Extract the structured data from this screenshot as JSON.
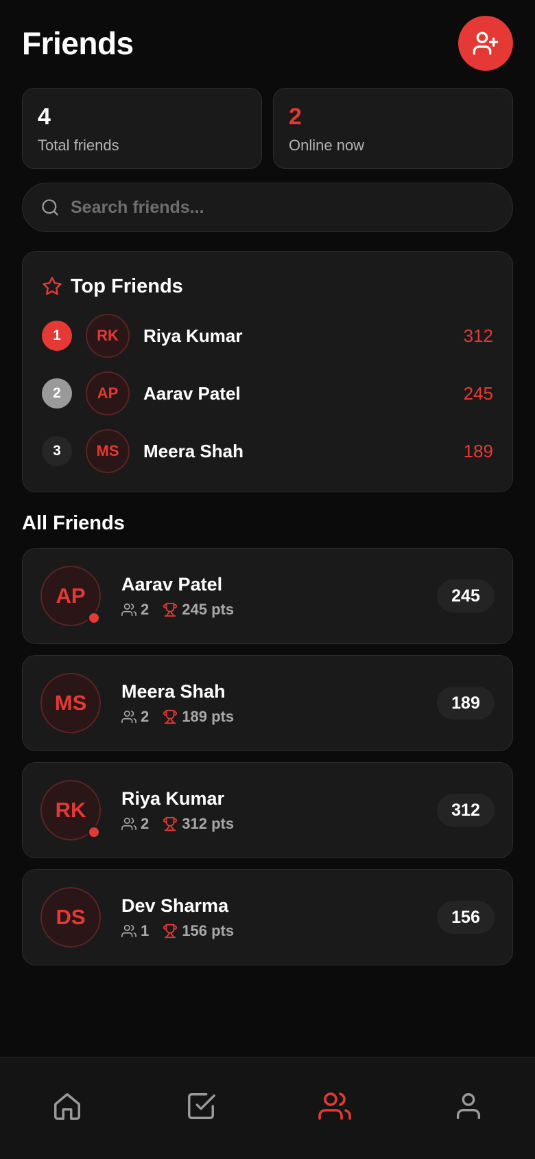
{
  "header": {
    "title": "Friends",
    "add_button_icon": "user-plus-icon"
  },
  "stats": [
    {
      "value": "4",
      "label": "Total friends"
    },
    {
      "value": "2",
      "label": "Online now"
    }
  ],
  "search": {
    "placeholder": "Search friends...",
    "value": ""
  },
  "top_friends": {
    "title": "Top Friends",
    "items": [
      {
        "rank": "1",
        "initials": "RK",
        "name": "Riya Kumar",
        "score": "312"
      },
      {
        "rank": "2",
        "initials": "AP",
        "name": "Aarav Patel",
        "score": "245"
      },
      {
        "rank": "3",
        "initials": "MS",
        "name": "Meera Shah",
        "score": "189"
      }
    ]
  },
  "all_friends": {
    "title": "All Friends",
    "items": [
      {
        "initials": "AP",
        "name": "Aarav Patel",
        "friends": "2",
        "points": "245 pts",
        "score": "245",
        "online": true
      },
      {
        "initials": "MS",
        "name": "Meera Shah",
        "friends": "2",
        "points": "189 pts",
        "score": "189",
        "online": false
      },
      {
        "initials": "RK",
        "name": "Riya Kumar",
        "friends": "2",
        "points": "312 pts",
        "score": "312",
        "online": true
      },
      {
        "initials": "DS",
        "name": "Dev Sharma",
        "friends": "1",
        "points": "156 pts",
        "score": "156",
        "online": false
      }
    ]
  },
  "nav": [
    {
      "icon": "home-icon",
      "active": false
    },
    {
      "icon": "check-square-icon",
      "active": false
    },
    {
      "icon": "users-icon",
      "active": true
    },
    {
      "icon": "user-icon",
      "active": false
    }
  ],
  "colors": {
    "accent": "#e53935",
    "background": "#0b0b0b",
    "card": "#1a1a1a",
    "muted": "#a8a8a8"
  }
}
